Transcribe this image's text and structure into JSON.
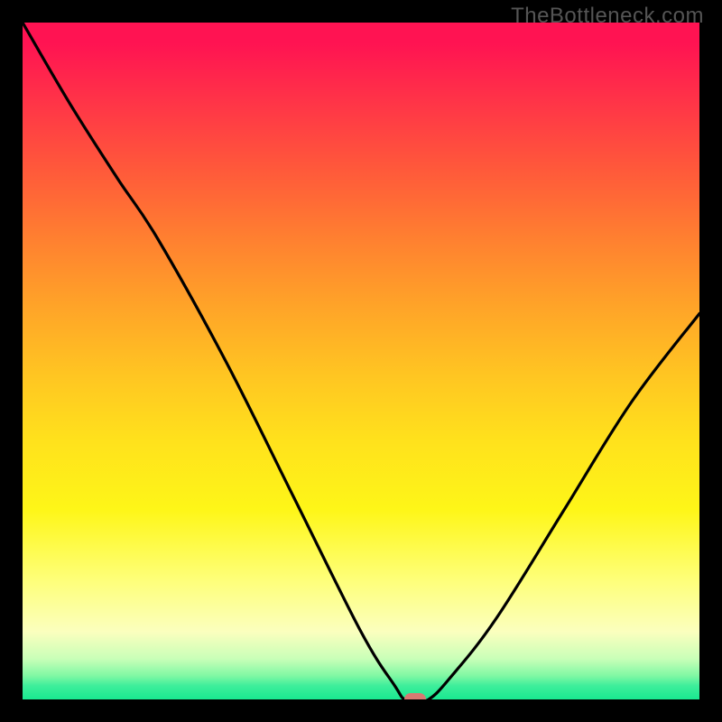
{
  "watermark": "TheBottleneck.com",
  "chart_data": {
    "type": "line",
    "title": "",
    "xlabel": "",
    "ylabel": "",
    "xlim": [
      0,
      100
    ],
    "ylim": [
      0,
      100
    ],
    "grid": false,
    "note": "V-shaped bottleneck curve; x = component balance position (0–100), y = bottleneck % (0 at minimum). Values estimated from gradient/curve.",
    "series": [
      {
        "name": "bottleneck-curve",
        "x": [
          0,
          7,
          14,
          20,
          30,
          40,
          50,
          55,
          56.5,
          58.5,
          60,
          63,
          70,
          80,
          90,
          100
        ],
        "values": [
          100,
          88,
          77,
          68,
          50,
          30,
          10,
          2,
          0,
          0,
          0,
          3,
          12,
          28,
          44,
          57
        ]
      }
    ],
    "marker": {
      "x": 58,
      "y": 0,
      "color": "#d77a72"
    },
    "gradient_stops": [
      {
        "pct": 0,
        "color": "#ff1352"
      },
      {
        "pct": 50,
        "color": "#ffc522"
      },
      {
        "pct": 85,
        "color": "#feff76"
      },
      {
        "pct": 100,
        "color": "#19e890"
      }
    ]
  }
}
